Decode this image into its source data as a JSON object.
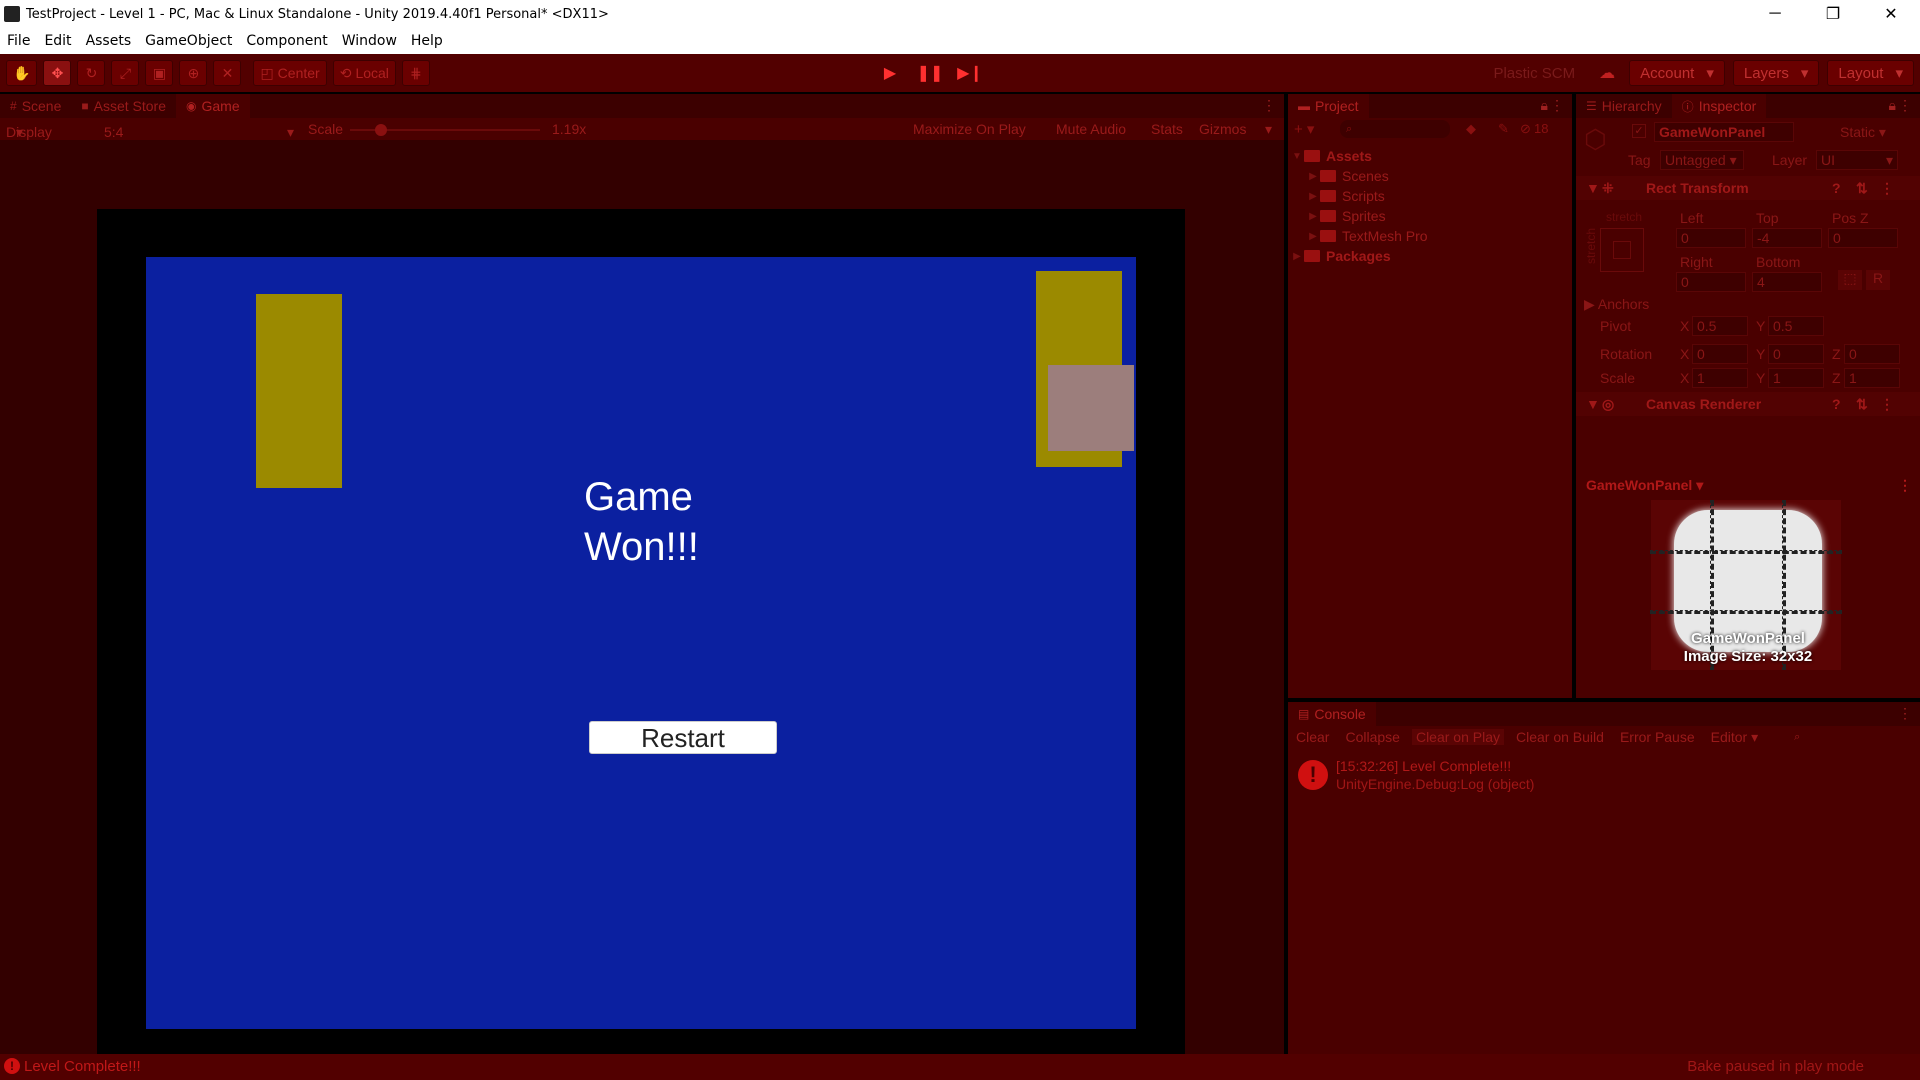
{
  "window": {
    "title": "TestProject - Level 1 - PC, Mac & Linux Standalone - Unity 2019.4.40f1 Personal* <DX11>",
    "minimize": "─",
    "restore": "❐",
    "close": "✕"
  },
  "menu": [
    "File",
    "Edit",
    "Assets",
    "GameObject",
    "Component",
    "Window",
    "Help"
  ],
  "toolbar": {
    "center_label": "Center",
    "local_label": "Local",
    "plastic_label": "Plastic SCM",
    "account_label": "Account",
    "layers_label": "Layers",
    "layout_label": "Layout",
    "icons": [
      "hand-icon",
      "move-icon",
      "rotate-icon",
      "scale-icon",
      "rect-icon",
      "transform-icon",
      "custom-tool-icon"
    ]
  },
  "left_tabs": {
    "scene": "Scene",
    "asset_store": "Asset Store",
    "game": "Game"
  },
  "game_bar": {
    "display": "Display 1",
    "aspect": "5:4",
    "scale_label": "Scale",
    "scale_value": "1.19x",
    "maximize": "Maximize On Play",
    "mute": "Mute Audio",
    "stats": "Stats",
    "gizmos": "Gizmos"
  },
  "game": {
    "won_line1": "Game",
    "won_line2": "Won!!!",
    "restart": "Restart",
    "colors": {
      "screen": "#0b20a0",
      "paddle": "#9b8a00",
      "ball": "#9c7e7c"
    }
  },
  "project": {
    "tab": "Project",
    "hidden_count": "18",
    "assets": "Assets",
    "folders": [
      "Scenes",
      "Scripts",
      "Sprites",
      "TextMesh Pro"
    ],
    "packages": "Packages"
  },
  "inspector": {
    "hierarchy_tab": "Hierarchy",
    "inspector_tab": "Inspector",
    "object_name": "GameWonPanel",
    "static_label": "Static",
    "tag_label": "Tag",
    "tag_value": "Untagged",
    "layer_label": "Layer",
    "layer_value": "UI",
    "rect_transform": "Rect Transform",
    "stretch": "stretch",
    "left_label": "Left",
    "top_label": "Top",
    "posz_label": "Pos Z",
    "left_value": "0",
    "top_value": "-4",
    "posz_value": "0",
    "right_label": "Right",
    "bottom_label": "Bottom",
    "right_value": "0",
    "bottom_value": "4",
    "anchors": "Anchors",
    "pivot": "Pivot",
    "pivot_x": "0.5",
    "pivot_y": "0.5",
    "rotation": "Rotation",
    "rot_x": "0",
    "rot_y": "0",
    "rot_z": "0",
    "scale": "Scale",
    "scale_x": "1",
    "scale_y": "1",
    "scale_z": "1",
    "canvas_renderer": "Canvas Renderer",
    "preview_title": "GameWonPanel",
    "preview_name": "GameWonPanel",
    "preview_size": "Image Size: 32x32"
  },
  "console": {
    "tab": "Console",
    "buttons": [
      "Clear",
      "Collapse",
      "Clear on Play",
      "Clear on Build",
      "Error Pause",
      "Editor"
    ],
    "log_line1": "[15:32:26] Level Complete!!!",
    "log_line2": "UnityEngine.Debug:Log (object)"
  },
  "status": {
    "message": "Level Complete!!!",
    "bake": "Bake paused in play mode"
  }
}
